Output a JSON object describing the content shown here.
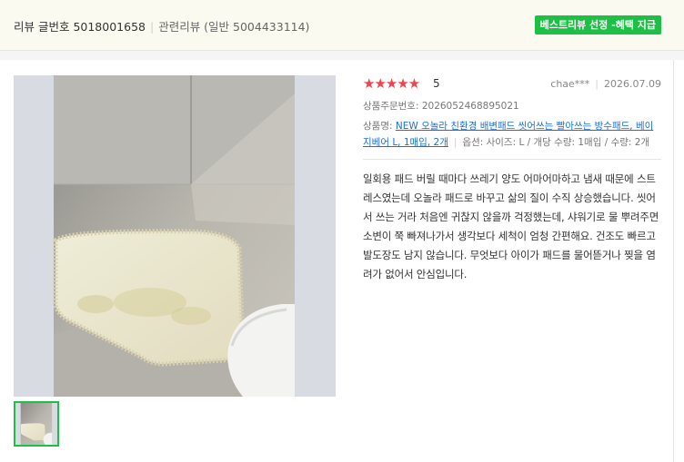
{
  "header": {
    "review_no_label": "리뷰 글번호 5018001658",
    "related_label": "관련리뷰 (일반 5004433114)",
    "badge": "베스트리뷰 선정 -혜택 지급"
  },
  "review": {
    "stars": "★★★★★",
    "rating": "5",
    "author": "chae***",
    "date": "2026.07.09",
    "order_number": "상품주문번호: 2026052468895021",
    "product_prefix": "상품명: ",
    "product_name": "NEW 오놀라 친환경 배변패드 씻어쓰는 빨아쓰는 방수패드, 베이지베어 L, 1매입, 2개",
    "option": "옵션: 사이즈: L / 개당 수량: 1매입 / 수량: 2개",
    "body": "일회용 패드 버릴 때마다 쓰레기 양도 어마어마하고 냄새 때문에 스트레스였는데 오놀라 패드로 바꾸고 삶의 질이 수직 상승했습니다. 씻어서 쓰는 거라 처음엔 귀찮지 않을까 걱정했는데, 샤워기로 물 뿌려주면 소변이 쭉 빠져나가서 생각보다 세척이 엄청 간편해요. 건조도 빠르고 발도장도 남지 않습니다. 무엇보다 아이가 패드를 물어뜯거나 찢을 염려가 없어서 안심입니다."
  },
  "colors": {
    "accent_green": "#1ebf45",
    "star_red": "#f1424d",
    "link_blue": "#1a6fd8"
  }
}
